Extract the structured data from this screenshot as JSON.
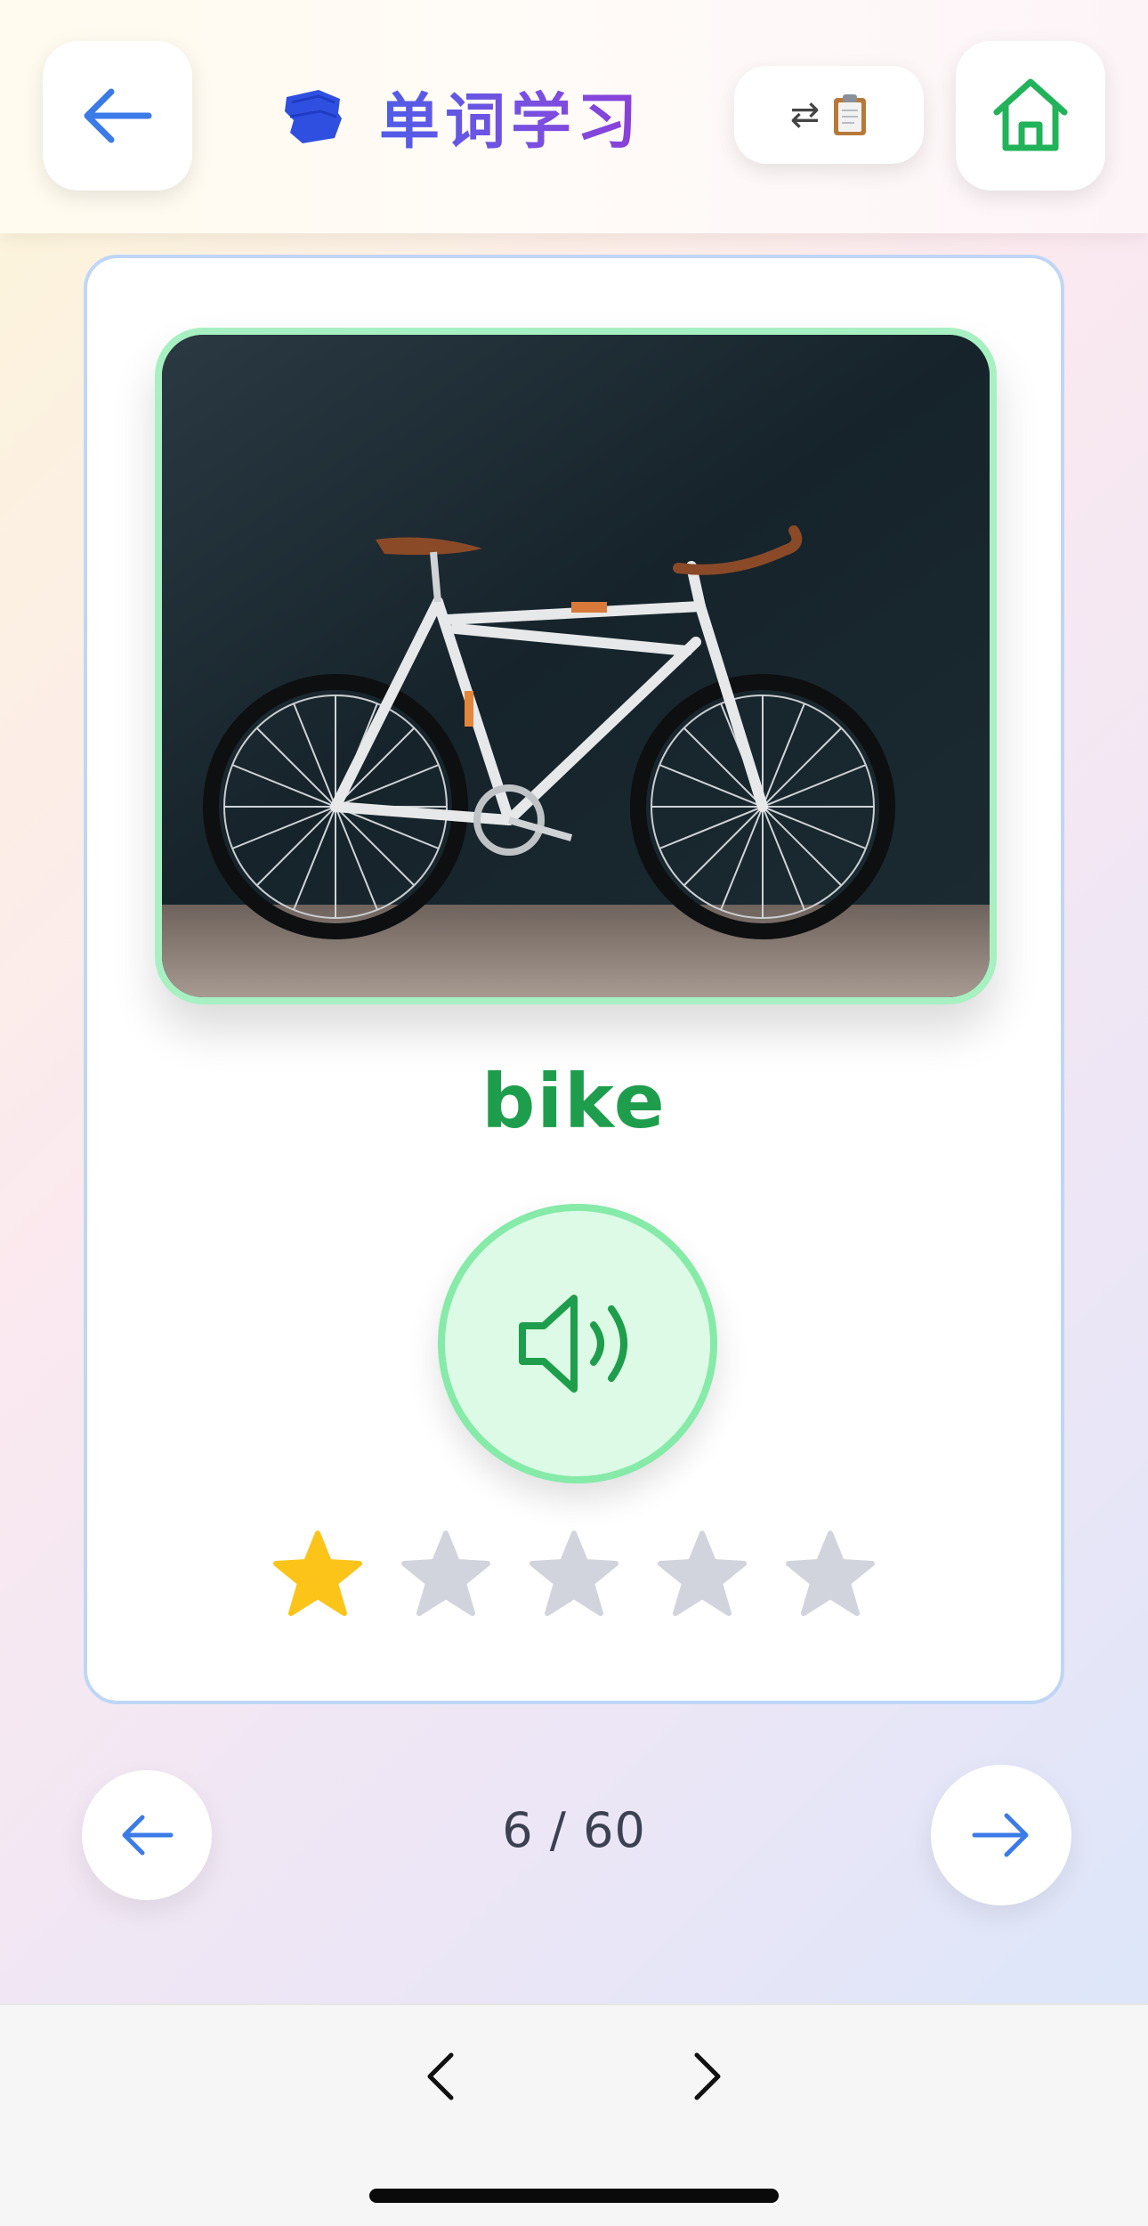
{
  "header": {
    "title": "单词学习",
    "title_icon": "book-stack-icon",
    "back_icon": "arrow-left-icon",
    "swap_icon": "swap-arrows-icon",
    "clipboard_icon": "clipboard-icon",
    "home_icon": "home-icon",
    "colors": {
      "accent_blue": "#3b7be8",
      "home_green": "#22b35a",
      "title_start": "#4f5de8",
      "title_end": "#8a3fd8"
    }
  },
  "card": {
    "image_subject": "bicycle",
    "word": "bike",
    "speaker_icon": "speaker-volume-icon",
    "rating": {
      "filled": 1,
      "total": 5
    },
    "colors": {
      "word": "#1e9e4c",
      "star_filled": "#fcc419",
      "star_empty": "#d1d4dc",
      "border": "#bfd6f6",
      "frame": "#a7f0c2"
    }
  },
  "pager": {
    "counter": "6 / 60",
    "prev_icon": "arrow-left-icon",
    "next_icon": "arrow-right-icon"
  },
  "browser_bar": {
    "back_icon": "chevron-left-icon",
    "forward_icon": "chevron-right-icon"
  }
}
